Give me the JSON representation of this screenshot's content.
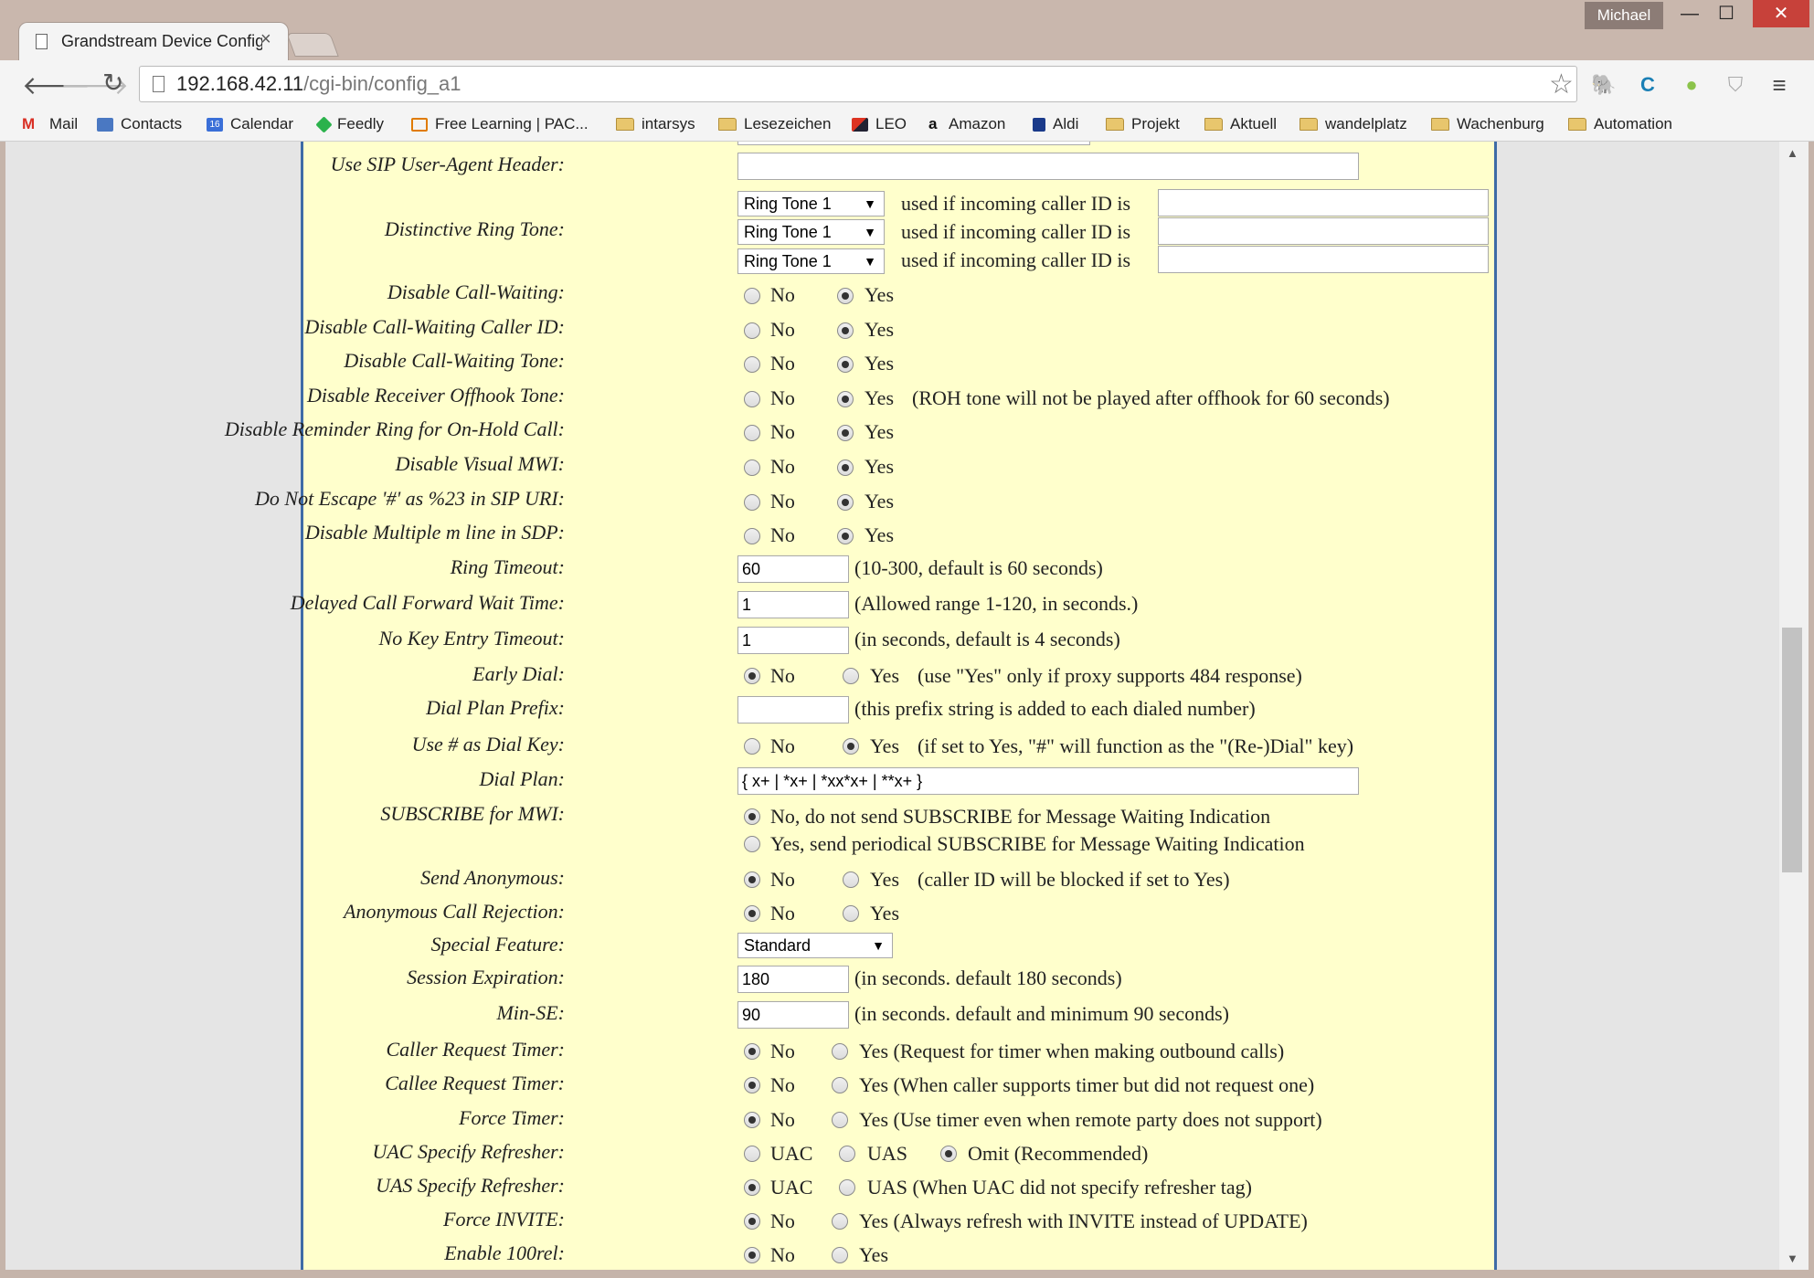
{
  "window": {
    "user": "Michael",
    "minimize": "—",
    "maximize": "☐",
    "close": "✕"
  },
  "tab": {
    "title": "Grandstream Device Configu",
    "close": "×"
  },
  "address": {
    "host": "192.168.42.11",
    "path": "/cgi-bin/config_a1"
  },
  "bookmarks": [
    "Mail",
    "Contacts",
    "Calendar",
    "Feedly",
    "Free Learning | PAC...",
    "intarsys",
    "Lesezeichen",
    "LEO",
    "Amazon",
    "Aldi",
    "Projekt",
    "Aktuell",
    "wandelplatz",
    "Wachenburg",
    "Automation"
  ],
  "calendar_day": "16",
  "icons": {
    "back": "back-arrow-icon",
    "forward": "forward-arrow-icon",
    "reload": "reload-icon",
    "star": "star-icon",
    "menu": "hamburger-menu-icon"
  },
  "colors": {
    "panel_bg": "#ffffcc",
    "panel_border": "#3e6ba6",
    "close_btn": "#c7413a"
  },
  "common": {
    "no": "No",
    "yes": "Yes"
  },
  "form": {
    "sip_user_agent": {
      "label": "Use SIP User-Agent Header:",
      "value": ""
    },
    "distinctive_ring": {
      "label": "Distinctive Ring Tone:",
      "tones": [
        "Ring Tone 1",
        "Ring Tone 1",
        "Ring Tone 1"
      ],
      "suffix": "used if incoming caller ID is"
    },
    "radios": [
      {
        "label": "Disable Call-Waiting:",
        "value": "Yes"
      },
      {
        "label": "Disable Call-Waiting Caller ID:",
        "value": "Yes"
      },
      {
        "label": "Disable Call-Waiting Tone:",
        "value": "Yes"
      },
      {
        "label": "Disable Receiver Offhook Tone:",
        "value": "Yes",
        "note": "(ROH tone will not be played after offhook for 60 seconds)"
      },
      {
        "label": "Disable Reminder Ring for On-Hold Call:",
        "value": "Yes"
      },
      {
        "label": "Disable Visual MWI:",
        "value": "Yes"
      },
      {
        "label": "Do Not Escape '#' as %23 in SIP URI:",
        "value": "Yes"
      },
      {
        "label": "Disable Multiple m line in SDP:",
        "value": "Yes"
      }
    ],
    "ring_timeout": {
      "label": "Ring Timeout:",
      "value": "60",
      "note": "(10-300, default is 60 seconds)"
    },
    "delayed_cf": {
      "label": "Delayed Call Forward Wait Time:",
      "value": "1",
      "note": "(Allowed range 1-120, in seconds.)"
    },
    "no_key_timeout": {
      "label": "No Key Entry Timeout:",
      "value": "1",
      "note": "(in seconds, default is 4 seconds)"
    },
    "early_dial": {
      "label": "Early Dial:",
      "value": "No",
      "note": "(use \"Yes\" only if proxy supports 484 response)"
    },
    "dial_prefix": {
      "label": "Dial Plan Prefix:",
      "value": "",
      "note": "(this prefix string is added to each dialed number)"
    },
    "hash_dial": {
      "label": "Use # as Dial Key:",
      "value": "Yes",
      "note": "(if set to Yes, \"#\" will function as the \"(Re-)Dial\" key)"
    },
    "dial_plan": {
      "label": "Dial Plan:",
      "value": "{ x+ | *x+ | *xx*x+ | **x+ }"
    },
    "subscribe_mwi": {
      "label": "SUBSCRIBE for MWI:",
      "opt_no": "No, do not send SUBSCRIBE for Message Waiting Indication",
      "opt_yes": "Yes, send periodical SUBSCRIBE for Message Waiting Indication",
      "value": "No"
    },
    "send_anon": {
      "label": "Send Anonymous:",
      "value": "No",
      "note": "(caller ID will be blocked if set to Yes)"
    },
    "anon_reject": {
      "label": "Anonymous Call Rejection:",
      "value": "No"
    },
    "special_feature": {
      "label": "Special Feature:",
      "value": "Standard"
    },
    "session_exp": {
      "label": "Session Expiration:",
      "value": "180",
      "note": "(in seconds. default 180 seconds)"
    },
    "min_se": {
      "label": "Min-SE:",
      "value": "90",
      "note": "(in seconds. default and minimum 90 seconds)"
    },
    "caller_timer": {
      "label": "Caller Request Timer:",
      "value": "No",
      "yes_text": "Yes (Request for timer when making outbound calls)"
    },
    "callee_timer": {
      "label": "Callee Request Timer:",
      "value": "No",
      "yes_text": "Yes (When caller supports timer but did not request one)"
    },
    "force_timer": {
      "label": "Force Timer:",
      "value": "No",
      "yes_text": "Yes (Use timer even when remote party does not support)"
    },
    "uac_refresher": {
      "label": "UAC Specify Refresher:",
      "opts": [
        "UAC",
        "UAS",
        "Omit (Recommended)"
      ],
      "value": "Omit (Recommended)"
    },
    "uas_refresher": {
      "label": "UAS Specify Refresher:",
      "opts": [
        "UAC",
        "UAS (When UAC did not specify refresher tag)"
      ],
      "value": "UAC"
    },
    "force_invite": {
      "label": "Force INVITE:",
      "value": "No",
      "yes_text": "Yes (Always refresh with INVITE instead of UPDATE)"
    },
    "enable_100rel": {
      "label": "Enable 100rel:",
      "value": "No",
      "yes_text": "Yes"
    }
  }
}
